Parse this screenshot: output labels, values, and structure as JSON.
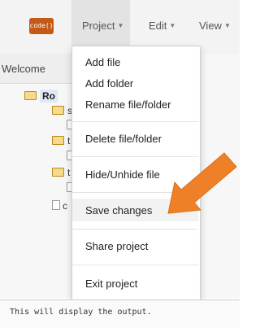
{
  "navbar": {
    "logo_text": "code()",
    "menus": [
      {
        "label": "Project",
        "caret": "▼"
      },
      {
        "label": "Edit",
        "caret": "▼"
      },
      {
        "label": "View",
        "caret": "▼"
      }
    ]
  },
  "panel": {
    "tab_label": "Welcome",
    "tree": {
      "root_label": "Ro",
      "items": [
        "s",
        "t",
        "t",
        "c"
      ]
    }
  },
  "project_menu": {
    "items": [
      "Add file",
      "Add folder",
      "Rename file/folder",
      "Delete file/folder",
      "Hide/Unhide file",
      "Save changes",
      "Share project",
      "Exit project"
    ]
  },
  "output": {
    "text": "This will display the output."
  },
  "colors": {
    "logo_bg": "#c35a16",
    "arrow": "#ee8128",
    "highlight": "#f2f2f2"
  },
  "icons": {
    "arrow": "arrow-pointer-icon",
    "folder": "folder-icon",
    "file": "file-icon"
  }
}
